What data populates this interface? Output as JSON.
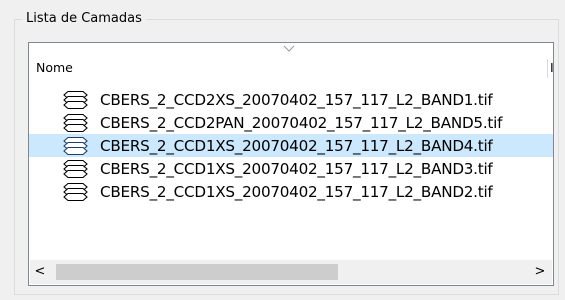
{
  "groupbox": {
    "title": "Lista de Camadas"
  },
  "listview": {
    "column_header": "Nome",
    "column_header_clipped": "I",
    "selected_index": 2,
    "items": [
      {
        "label": "CBERS_2_CCD2XS_20070402_157_117_L2_BAND1.tif",
        "icon": "layer-stack-icon"
      },
      {
        "label": "CBERS_2_CCD2PAN_20070402_157_117_L2_BAND5.tif",
        "icon": "layer-stack-icon"
      },
      {
        "label": "CBERS_2_CCD1XS_20070402_157_117_L2_BAND4.tif",
        "icon": "layer-stack-icon"
      },
      {
        "label": "CBERS_2_CCD1XS_20070402_157_117_L2_BAND3.tif",
        "icon": "layer-stack-icon"
      },
      {
        "label": "CBERS_2_CCD1XS_20070402_157_117_L2_BAND2.tif",
        "icon": "layer-stack-icon"
      }
    ]
  },
  "scrollbar": {
    "left_arrow": "<",
    "right_arrow": ">",
    "thumb_fraction": 0.57
  },
  "colors": {
    "selection": "#cce8ff",
    "border": "#828790",
    "background": "#f0f0f0"
  }
}
